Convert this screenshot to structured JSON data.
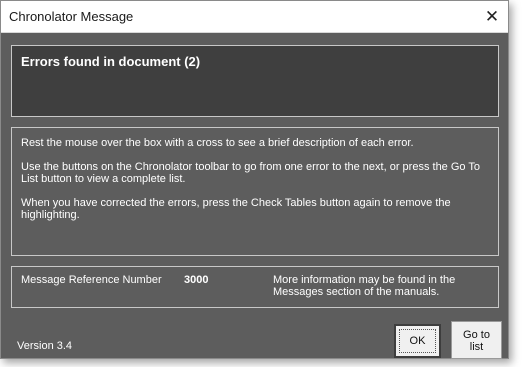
{
  "window": {
    "title": "Chronolator Message",
    "close_glyph": "✕"
  },
  "error_box": {
    "title": "Errors found in document (2)"
  },
  "info": {
    "paragraphs": [
      "Rest the mouse over the box with a cross to see a brief description of each error.",
      "Use the buttons on the Chronolator toolbar to go from one error to the next, or press the Go To List button to view a complete list.",
      "When you have corrected the errors, press the Check Tables button again to remove the highlighting."
    ]
  },
  "reference": {
    "label": "Message Reference Number",
    "number": "3000",
    "more_info": "More information may be found in the Messages section of the manuals."
  },
  "footer": {
    "version": "Version 3.4",
    "ok_label": "OK",
    "goto_label": "Go to\nlist"
  },
  "colors": {
    "dialog_background": "#5d5d5d",
    "error_box_background": "#3f3f3f",
    "text": "#ffffff"
  }
}
